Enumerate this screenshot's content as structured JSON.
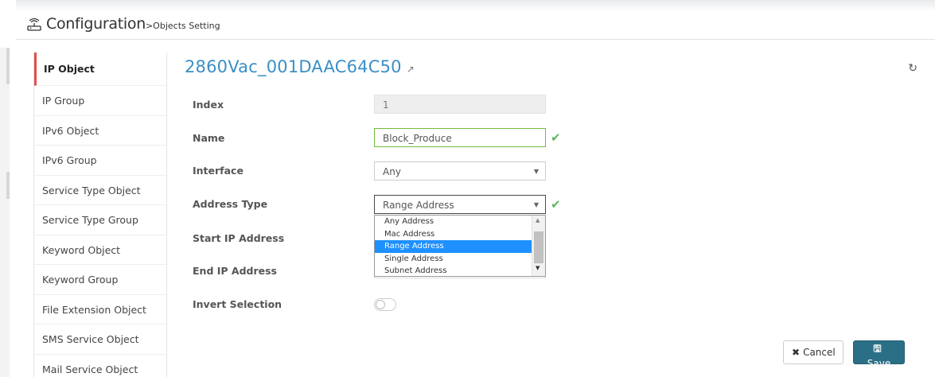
{
  "header": {
    "title": "Configuration",
    "subtitle": ">Objects Setting"
  },
  "sidebar": {
    "items": [
      {
        "label": "IP Object"
      },
      {
        "label": "IP Group"
      },
      {
        "label": "IPv6 Object"
      },
      {
        "label": "IPv6 Group"
      },
      {
        "label": "Service Type Object"
      },
      {
        "label": "Service Type Group"
      },
      {
        "label": "Keyword Object"
      },
      {
        "label": "Keyword Group"
      },
      {
        "label": "File Extension Object"
      },
      {
        "label": "SMS Service Object"
      },
      {
        "label": "Mail Service Object"
      }
    ]
  },
  "main": {
    "device": "2860Vac_001DAAC64C50",
    "fields": {
      "index": {
        "label": "Index",
        "value": "1"
      },
      "name": {
        "label": "Name",
        "value": "Block_Produce"
      },
      "interface": {
        "label": "Interface",
        "value": "Any"
      },
      "address_type": {
        "label": "Address Type",
        "value": "Range Address"
      },
      "start_ip": {
        "label": "Start IP Address"
      },
      "end_ip": {
        "label": "End IP Address"
      },
      "invert": {
        "label": "Invert Selection",
        "on": false
      }
    },
    "address_options": [
      "Any Address",
      "Mac Address",
      "Range Address",
      "Single Address",
      "Subnet Address"
    ],
    "selected_option_index": 2
  },
  "buttons": {
    "cancel": "Cancel",
    "save": "Save"
  },
  "icons": {
    "header": "router-icon",
    "external": "external-link-icon",
    "refresh": "refresh-icon",
    "check": "check-icon",
    "cancel": "close-icon",
    "save": "floppy-disk-icon"
  },
  "colors": {
    "accent": "#3a8fc5",
    "active_marker": "#d9534f",
    "valid": "#5cb85c",
    "save_button": "#2b6f86",
    "selected_option": "#1e90ff"
  }
}
